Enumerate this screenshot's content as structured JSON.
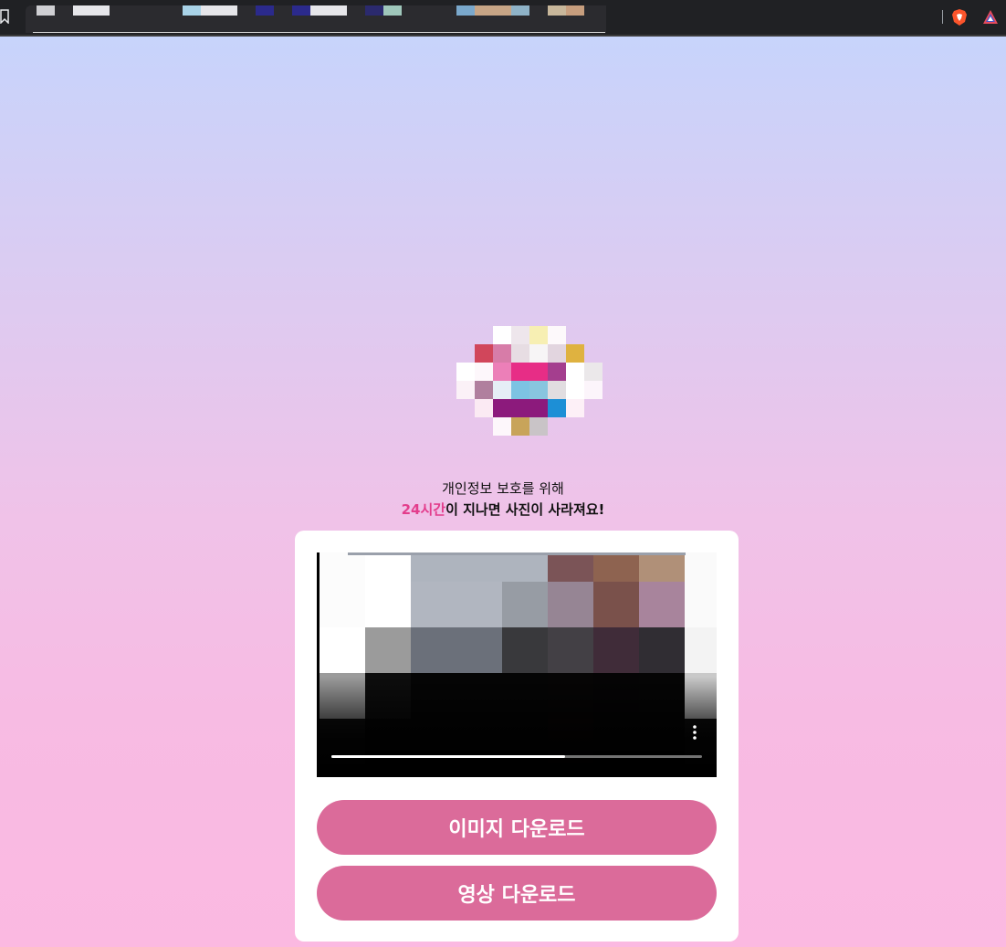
{
  "notice": {
    "line1": "개인정보 보호를 위해",
    "highlight": "24시간",
    "line2_rest": "이 지나면 사진이 사라져요!"
  },
  "video": {
    "progress": 0.63
  },
  "buttons": {
    "image_download": "이미지 다운로드",
    "video_download": "영상 다운로드"
  },
  "colors": {
    "accent": "#db6b9a",
    "highlight": "#e33d8c"
  },
  "icons": {
    "bookmark": "bookmark-icon",
    "brave": "brave-shield-icon",
    "extension": "extension-triangle-icon",
    "more": "more-vertical-icon"
  }
}
